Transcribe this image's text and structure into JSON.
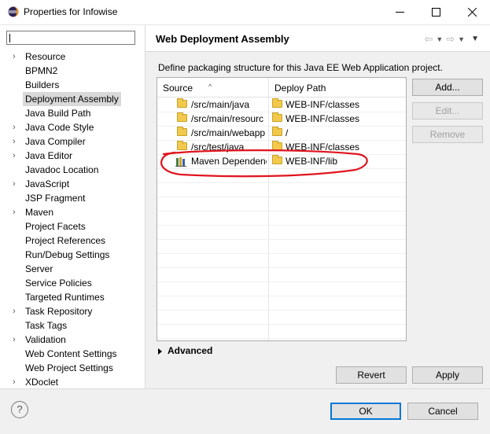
{
  "window": {
    "title": "Properties for Infowise",
    "app_icon": "eclipse-icon"
  },
  "filter": {
    "value": ""
  },
  "nav": {
    "items": [
      {
        "label": "Resource",
        "expandable": true,
        "selected": false
      },
      {
        "label": "BPMN2",
        "expandable": false,
        "selected": false
      },
      {
        "label": "Builders",
        "expandable": false,
        "selected": false
      },
      {
        "label": "Deployment Assembly",
        "expandable": false,
        "selected": true
      },
      {
        "label": "Java Build Path",
        "expandable": false,
        "selected": false
      },
      {
        "label": "Java Code Style",
        "expandable": true,
        "selected": false
      },
      {
        "label": "Java Compiler",
        "expandable": true,
        "selected": false
      },
      {
        "label": "Java Editor",
        "expandable": true,
        "selected": false
      },
      {
        "label": "Javadoc Location",
        "expandable": false,
        "selected": false
      },
      {
        "label": "JavaScript",
        "expandable": true,
        "selected": false
      },
      {
        "label": "JSP Fragment",
        "expandable": false,
        "selected": false
      },
      {
        "label": "Maven",
        "expandable": true,
        "selected": false
      },
      {
        "label": "Project Facets",
        "expandable": false,
        "selected": false
      },
      {
        "label": "Project References",
        "expandable": false,
        "selected": false
      },
      {
        "label": "Run/Debug Settings",
        "expandable": false,
        "selected": false
      },
      {
        "label": "Server",
        "expandable": false,
        "selected": false
      },
      {
        "label": "Service Policies",
        "expandable": false,
        "selected": false
      },
      {
        "label": "Targeted Runtimes",
        "expandable": false,
        "selected": false
      },
      {
        "label": "Task Repository",
        "expandable": true,
        "selected": false
      },
      {
        "label": "Task Tags",
        "expandable": false,
        "selected": false
      },
      {
        "label": "Validation",
        "expandable": true,
        "selected": false
      },
      {
        "label": "Web Content Settings",
        "expandable": false,
        "selected": false
      },
      {
        "label": "Web Project Settings",
        "expandable": false,
        "selected": false
      },
      {
        "label": "XDoclet",
        "expandable": true,
        "selected": false
      }
    ]
  },
  "page": {
    "title": "Web Deployment Assembly",
    "description": "Define packaging structure for this Java EE Web Application project."
  },
  "table": {
    "columns": [
      "Source",
      "Deploy Path"
    ],
    "rows": [
      {
        "source": "/src/main/java",
        "source_icon": "folder-icon",
        "deploy": "WEB-INF/classes"
      },
      {
        "source": "/src/main/resourc",
        "source_icon": "folder-icon",
        "deploy": "WEB-INF/classes"
      },
      {
        "source": "/src/main/webapp",
        "source_icon": "folder-icon",
        "deploy": "/"
      },
      {
        "source": "/src/test/java",
        "source_icon": "folder-icon",
        "deploy": "WEB-INF/classes"
      },
      {
        "source": "Maven Dependenc",
        "source_icon": "library-icon",
        "deploy": "WEB-INF/lib"
      }
    ]
  },
  "side_buttons": {
    "add": "Add...",
    "edit": "Edit...",
    "remove": "Remove"
  },
  "advanced": {
    "label": "Advanced"
  },
  "apply_buttons": {
    "revert": "Revert",
    "apply": "Apply"
  },
  "dialog_buttons": {
    "ok": "OK",
    "cancel": "Cancel"
  },
  "help": {
    "glyph": "?"
  },
  "colors": {
    "selection": "#d9d9d9",
    "highlight_mark": "#e0141e",
    "focus": "#0078d7"
  }
}
